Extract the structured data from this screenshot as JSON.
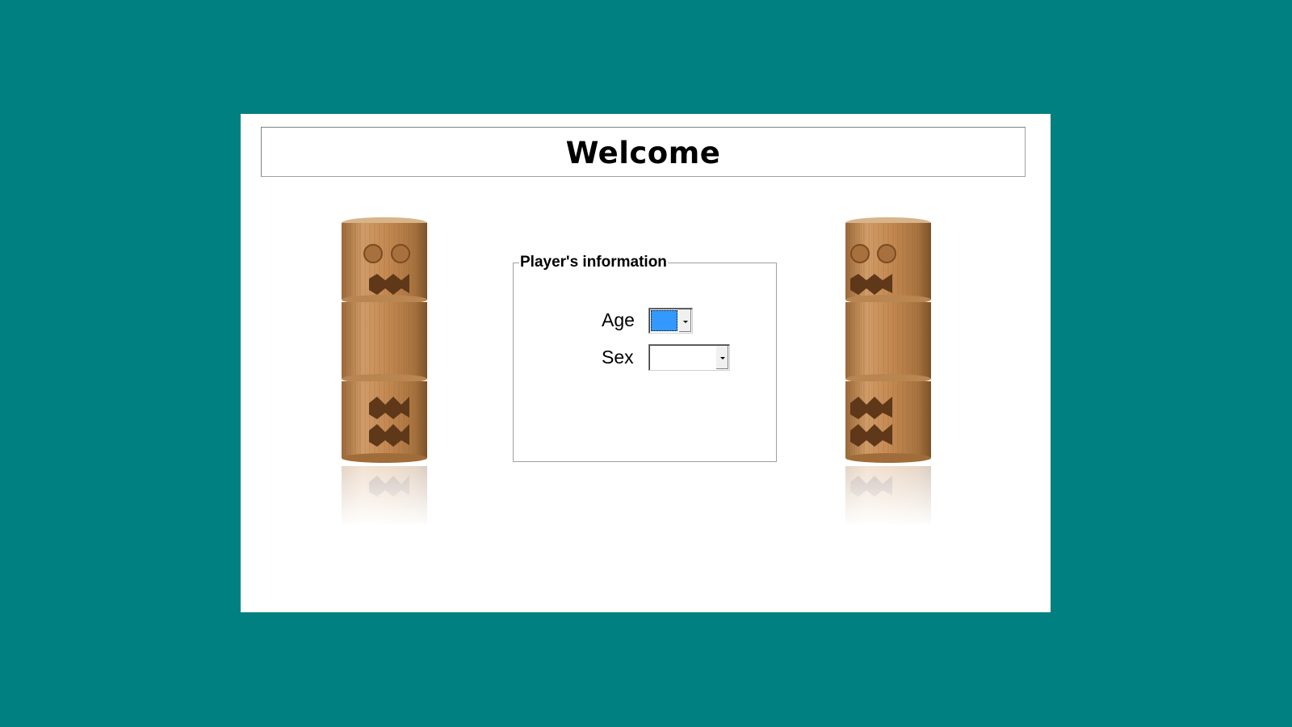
{
  "header": {
    "title": "Welcome"
  },
  "form": {
    "legend": "Player's information",
    "age_label": "Age",
    "sex_label": "Sex",
    "age_value": "",
    "sex_value": ""
  },
  "colors": {
    "background": "#008080",
    "panel": "#ffffff",
    "selection": "#3399ff",
    "wood_light": "#c8935c",
    "wood_dark": "#8a5a2e"
  },
  "icons": {
    "left_decoration": "wooden-totem",
    "right_decoration": "wooden-totem"
  }
}
